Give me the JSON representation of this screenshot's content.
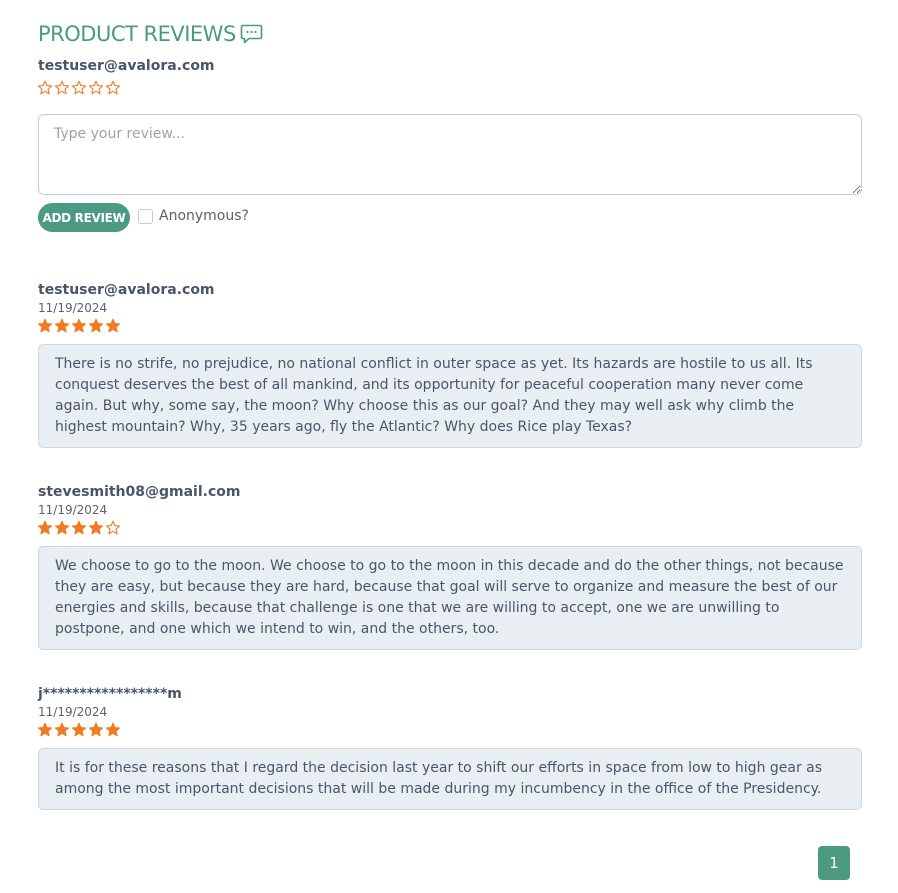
{
  "header": {
    "title": "PRODUCT REVIEWS",
    "title_icon": "chat-bubble-icon",
    "accent_color": "#4c9a82"
  },
  "compose": {
    "user": "testuser@avalora.com",
    "rating": 0,
    "placeholder": "Type your review...",
    "add_button": "ADD REVIEW",
    "anonymous_label": "Anonymous?",
    "anonymous_checked": false
  },
  "reviews": [
    {
      "author": "testuser@avalora.com",
      "date": "11/19/2024",
      "rating": 5,
      "text": "There is no strife, no prejudice, no national conflict in outer space as yet. Its hazards are hostile to us all. Its conquest deserves the best of all mankind, and its opportunity for peaceful cooperation many never come again. But why, some say, the moon? Why choose this as our goal? And they may well ask why climb the highest mountain? Why, 35 years ago, fly the Atlantic? Why does Rice play Texas?"
    },
    {
      "author": "stevesmith08@gmail.com",
      "date": "11/19/2024",
      "rating": 4,
      "text": "We choose to go to the moon. We choose to go to the moon in this decade and do the other things, not because they are easy, but because they are hard, because that goal will serve to organize and measure the best of our energies and skills, because that challenge is one that we are willing to accept, one we are unwilling to postpone, and one which we intend to win, and the others, too."
    },
    {
      "author": "j*****************m",
      "date": "11/19/2024",
      "rating": 5,
      "text": "It is for these reasons that I regard the decision last year to shift our efforts in space from low to high gear as among the most important decisions that will be made during my incumbency in the office of the Presidency."
    }
  ],
  "pagination": {
    "current_page": "1"
  },
  "colors": {
    "star": "#f07b22",
    "review_bg": "#e9eef3"
  }
}
